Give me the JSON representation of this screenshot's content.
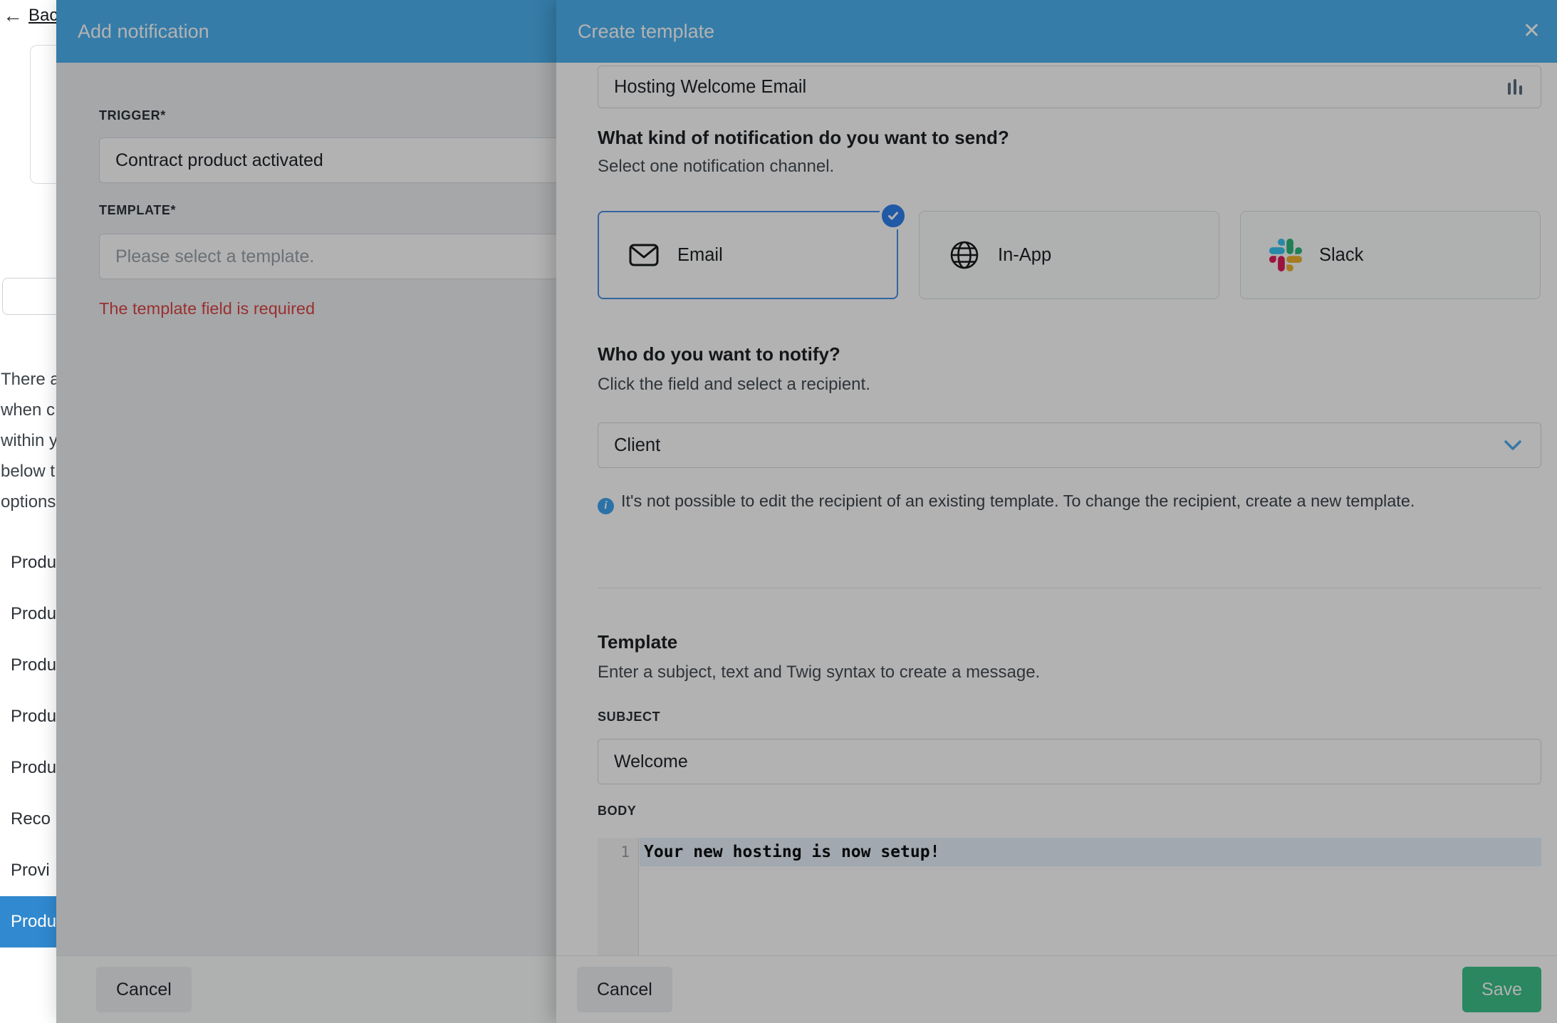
{
  "colors": {
    "header_blue": "#4cb2f1",
    "selected_border_blue": "#4a90e2",
    "check_blue": "#2f80ed",
    "save_green": "#3dc28a",
    "error_red": "#dc4545",
    "active_item_blue": "#3189cf",
    "slack_logo": [
      "#36C5F0",
      "#2EB67D",
      "#ECB22E",
      "#E01E5A"
    ]
  },
  "background": {
    "back_link_label": "Bac",
    "paragraph_lines": [
      "There a",
      "when c",
      "within y",
      "below t",
      "options"
    ],
    "menu_items": [
      {
        "label": "Produ",
        "active": false
      },
      {
        "label": "Produ",
        "active": false
      },
      {
        "label": "Produ",
        "active": false
      },
      {
        "label": "Produ",
        "active": false
      },
      {
        "label": "Produ",
        "active": false
      },
      {
        "label": "Reco",
        "active": false
      },
      {
        "label": "Provi",
        "active": false
      },
      {
        "label": "Produ",
        "active": true
      }
    ]
  },
  "add_notification": {
    "title": "Add notification",
    "trigger_label": "TRIGGER*",
    "trigger_value": "Contract product activated",
    "template_label": "TEMPLATE*",
    "template_placeholder": "Please select a template.",
    "error": "The template field is required",
    "cancel_label": "Cancel"
  },
  "create_template": {
    "title": "Create template",
    "close_icon": "✕",
    "name_value": "Hosting Welcome Email",
    "channel": {
      "heading": "What kind of notification do you want to send?",
      "subheading": "Select one notification channel.",
      "options": [
        {
          "label": "Email",
          "selected": true
        },
        {
          "label": "In-App",
          "selected": false
        },
        {
          "label": "Slack",
          "selected": false
        }
      ]
    },
    "recipient": {
      "heading": "Who do you want to notify?",
      "subheading": "Click the field and select a recipient.",
      "value": "Client",
      "info": "It's not possible to edit the recipient of an existing template. To change the recipient, create a new template."
    },
    "template_section": {
      "heading": "Template",
      "subheading": "Enter a subject, text and Twig syntax to create a message.",
      "subject_label": "SUBJECT",
      "subject_value": "Welcome",
      "body_label": "BODY",
      "line_number": "1",
      "body_value": "Your new hosting is now setup!"
    },
    "footer": {
      "cancel_label": "Cancel",
      "save_label": "Save"
    }
  }
}
